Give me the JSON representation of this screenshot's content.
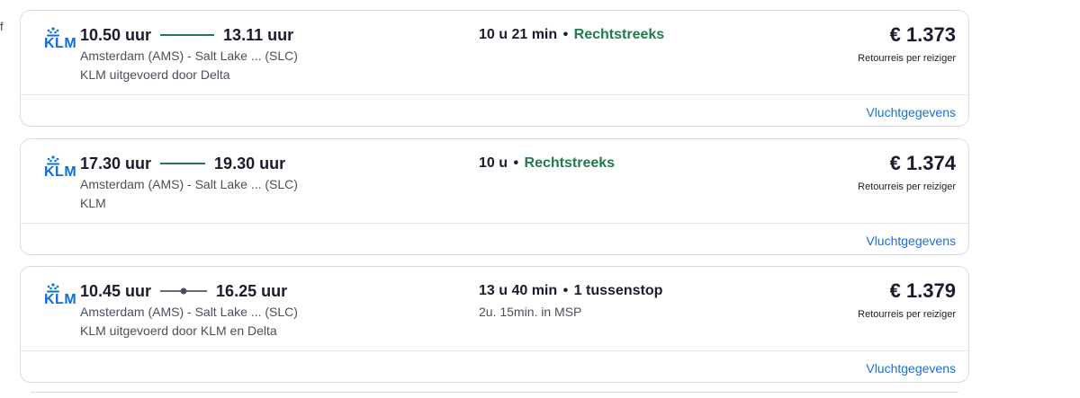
{
  "edge_text": "f",
  "flights": [
    {
      "airline_logo": "KLM",
      "depart": "10.50 uur",
      "arrive": "13.11 uur",
      "connector": "direct",
      "route": "Amsterdam (AMS) - Salt Lake ... (SLC)",
      "carrier": "KLM uitgevoerd door Delta",
      "duration": "10 u 21 min",
      "separator": "•",
      "stops": "Rechtstreeks",
      "stops_type": "direct",
      "layover": "",
      "price": "€ 1.373",
      "price_note": "Retourreis per reiziger",
      "details_link": "Vluchtgegevens"
    },
    {
      "airline_logo": "KLM",
      "depart": "17.30 uur",
      "arrive": "19.30 uur",
      "connector": "direct",
      "route": "Amsterdam (AMS) - Salt Lake ... (SLC)",
      "carrier": "KLM",
      "duration": "10 u",
      "separator": "•",
      "stops": "Rechtstreeks",
      "stops_type": "direct",
      "layover": "",
      "price": "€ 1.374",
      "price_note": "Retourreis per reiziger",
      "details_link": "Vluchtgegevens"
    },
    {
      "airline_logo": "KLM",
      "depart": "10.45 uur",
      "arrive": "16.25 uur",
      "connector": "one-stop",
      "route": "Amsterdam (AMS) - Salt Lake ... (SLC)",
      "carrier": "KLM uitgevoerd door KLM en Delta",
      "duration": "13 u 40 min",
      "separator": "•",
      "stops": "1 tussenstop",
      "stops_type": "stop",
      "layover": "2u. 15min. in MSP",
      "price": "€ 1.379",
      "price_note": "Retourreis per reiziger",
      "details_link": "Vluchtgegevens"
    }
  ],
  "colors": {
    "brand_blue": "#0a6fd8",
    "direct_green": "#1e7b4b",
    "link_blue": "#1a6fd6",
    "stop_gray": "#6b6f7a"
  }
}
